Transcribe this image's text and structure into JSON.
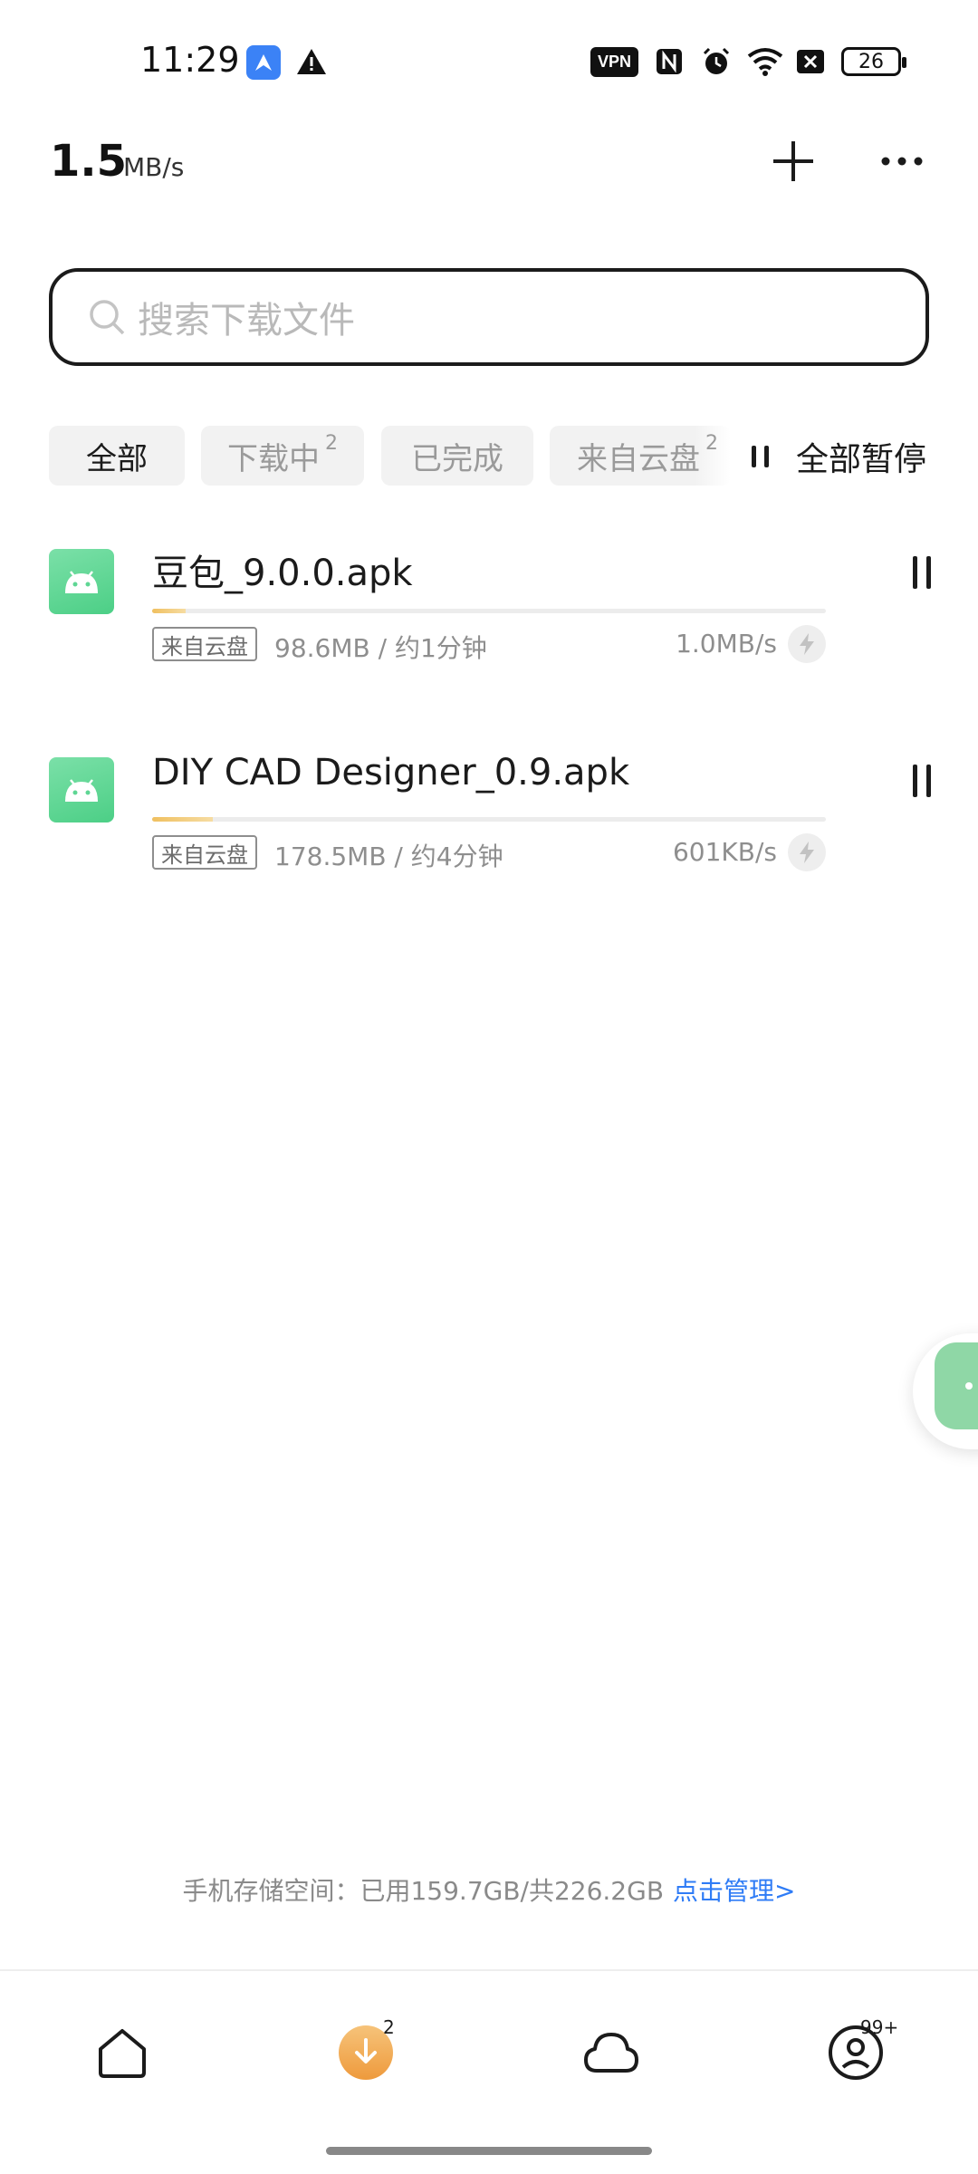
{
  "status_bar": {
    "time": "11:29",
    "vpn_label": "VPN",
    "battery_level": "26",
    "icons": [
      "app-notification-icon",
      "alert-icon",
      "nfc-icon",
      "alarm-icon",
      "wifi-icon",
      "sim-off-icon",
      "battery-icon"
    ]
  },
  "header": {
    "speed_value": "1.5",
    "speed_unit": "MB/s",
    "add_icon": "plus-icon",
    "more_icon": "more-icon"
  },
  "search": {
    "placeholder": "搜索下载文件"
  },
  "tabs": [
    {
      "label": "全部",
      "badge": "",
      "active": true
    },
    {
      "label": "下载中",
      "badge": "2",
      "active": false
    },
    {
      "label": "已完成",
      "badge": "",
      "active": false
    },
    {
      "label": "来自云盘",
      "badge": "2",
      "active": false
    }
  ],
  "pause_all_label": "全部暂停",
  "downloads": [
    {
      "name": "豆包_9.0.0.apk",
      "source": "来自云盘",
      "size_info": "98.6MB / 约1分钟",
      "rate": "1.0MB/s",
      "progress": 0.05
    },
    {
      "name": "DIY CAD Designer_0.9.apk",
      "source": "来自云盘",
      "size_info": "178.5MB / 约4分钟",
      "rate": "601KB/s",
      "progress": 0.09
    }
  ],
  "storage": {
    "text": "手机存储空间：已用159.7GB/共226.2GB",
    "manage_link": "点击管理>"
  },
  "bottom_nav": {
    "items": [
      {
        "icon": "home-icon",
        "badge": ""
      },
      {
        "icon": "download-icon",
        "badge": "2"
      },
      {
        "icon": "cloud-icon",
        "badge": ""
      },
      {
        "icon": "profile-icon",
        "badge": "99+"
      }
    ]
  },
  "colors": {
    "accent_link": "#2f7cf6",
    "download_orange": "#f0a34b",
    "apk_green": "#5fd694",
    "progress": "#f0c060"
  }
}
